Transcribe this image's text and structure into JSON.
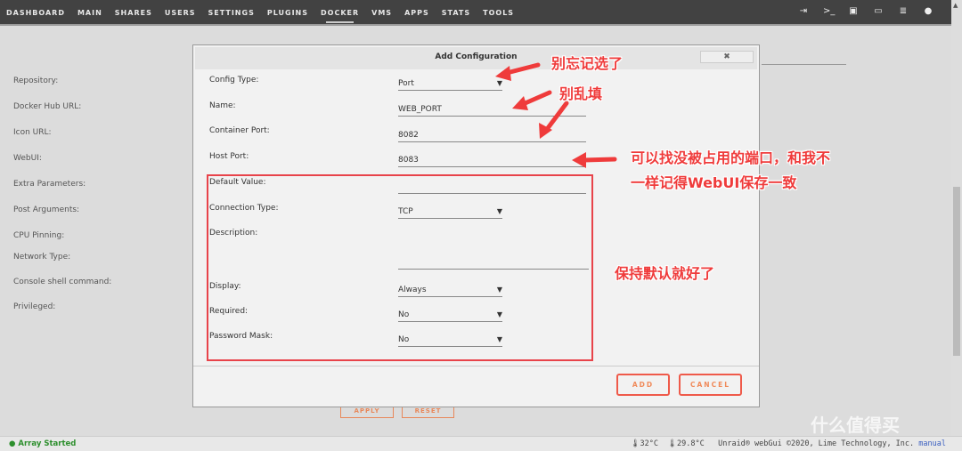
{
  "nav": {
    "items": [
      "DASHBOARD",
      "MAIN",
      "SHARES",
      "USERS",
      "SETTINGS",
      "PLUGINS",
      "DOCKER",
      "VMS",
      "APPS",
      "STATS",
      "TOOLS"
    ],
    "active": "DOCKER",
    "icons": [
      "logout-icon",
      "terminal-icon",
      "feedback-icon",
      "display-icon",
      "log-icon",
      "help-icon"
    ]
  },
  "background": {
    "labels": [
      "Repository:",
      "Docker Hub URL:",
      "Icon URL:",
      "WebUI:",
      "Extra Parameters:",
      "Post Arguments:",
      "CPU Pinning:",
      "Network Type:",
      "Console shell command:",
      "Privileged:"
    ],
    "apply": "APPLY",
    "reset": "RESET"
  },
  "modal": {
    "title": "Add Configuration",
    "close": "✖",
    "fields": [
      {
        "label": "Config Type:",
        "value": "Port",
        "type": "select"
      },
      {
        "label": "Name:",
        "value": "WEB_PORT",
        "type": "text"
      },
      {
        "label": "Container Port:",
        "value": "8082",
        "type": "text"
      },
      {
        "label": "Host Port:",
        "value": "8083",
        "type": "text"
      },
      {
        "label": "Default Value:",
        "value": "",
        "type": "text"
      },
      {
        "label": "Connection Type:",
        "value": "TCP",
        "type": "select"
      },
      {
        "label": "Description:",
        "value": "",
        "type": "text"
      },
      {
        "label": "Display:",
        "value": "Always",
        "type": "select"
      },
      {
        "label": "Required:",
        "value": "No",
        "type": "select"
      },
      {
        "label": "Password Mask:",
        "value": "No",
        "type": "select"
      }
    ],
    "add": "ADD",
    "cancel": "CANCEL"
  },
  "annotations": {
    "a1": "别忘记选了",
    "a2": "别乱填",
    "a3_line1": "可以找没被占用的端口，和我不",
    "a3_line2": "一样记得WebUI保存一致",
    "a4": "保持默认就好了",
    "color": "#ef3b3b"
  },
  "footer": {
    "status": "Array Started",
    "temp1": "32°C",
    "temp2": "29.8°C",
    "copyright": "Unraid® webGui ©2020, Lime Technology, Inc.",
    "manual": "manual"
  },
  "watermark": "什么值得买"
}
